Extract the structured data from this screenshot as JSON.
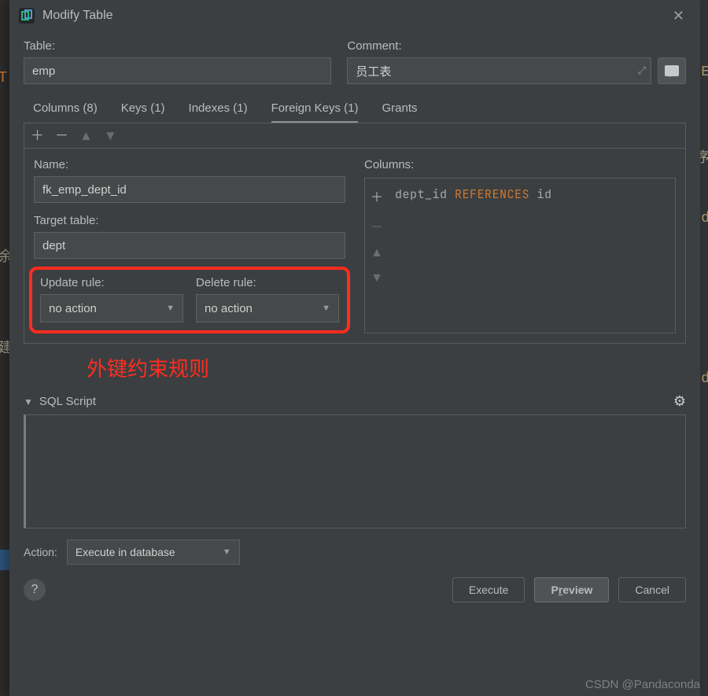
{
  "titlebar": {
    "title": "Modify Table"
  },
  "table_section": {
    "label": "Table:",
    "value": "emp"
  },
  "comment_section": {
    "label": "Comment:",
    "value": "员工表"
  },
  "tabs": [
    {
      "label": "Columns (8)",
      "active": false
    },
    {
      "label": "Keys (1)",
      "active": false
    },
    {
      "label": "Indexes (1)",
      "active": false
    },
    {
      "label": "Foreign Keys (1)",
      "active": true
    },
    {
      "label": "Grants",
      "active": false
    }
  ],
  "fk": {
    "name_label": "Name:",
    "name_value": "fk_emp_dept_id",
    "target_label": "Target table:",
    "target_value": "dept",
    "update_rule_label": "Update rule:",
    "update_rule_value": "no action",
    "delete_rule_label": "Delete rule:",
    "delete_rule_value": "no action"
  },
  "columns_panel": {
    "label": "Columns:",
    "text_pre": "dept_id ",
    "text_kw": "REFERENCES",
    "text_post": " id"
  },
  "annotation": "外键约束规则",
  "script": {
    "header": "SQL Script"
  },
  "action_row": {
    "label": "Action:",
    "value": "Execute in database"
  },
  "buttons": {
    "execute": "Execute",
    "preview_pre": "P",
    "preview_ul": "r",
    "preview_post": "eview",
    "cancel": "Cancel"
  },
  "watermark": "CSDN @Pandaconda",
  "bg_peek": {
    "c1": "E",
    "c2": "d",
    "c3": "d",
    "cn1": "T",
    "cn2": "余",
    "cn3": "建",
    "cn4": "序"
  }
}
